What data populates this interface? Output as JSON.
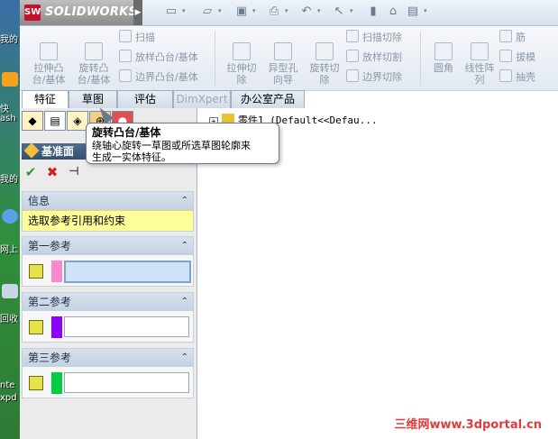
{
  "app": {
    "brand": "SOLIDWORKS",
    "logo_mark": "SW"
  },
  "desktop": {
    "labels": [
      "我的",
      "快",
      "ash",
      "我的",
      "网上",
      "回收",
      "nte",
      "xpd"
    ]
  },
  "toolbar": {
    "icons": [
      "new-file-icon",
      "open-icon",
      "save-icon",
      "print-icon",
      "undo-icon",
      "select-icon",
      "rebuild-icon",
      "file-props-icon",
      "options-icon"
    ]
  },
  "ribbon": {
    "extrude_boss": "拉伸凸\n台/基体",
    "revolve_boss": "旋转凸\n台/基体",
    "sweep": "扫描",
    "loft_boss": "放样凸台/基体",
    "boundary_boss": "边界凸台/基体",
    "extrude_cut": "拉伸切\n除",
    "hole_wizard": "异型孔\n向导",
    "revolve_cut": "旋转切\n除",
    "sweep_cut": "扫描切除",
    "loft_cut": "放样切割",
    "boundary_cut": "边界切除",
    "fillet": "圆角",
    "linear_pattern": "线性阵\n列",
    "rib": "筋",
    "draft": "拔模",
    "shell": "抽壳"
  },
  "tabs": [
    {
      "label": "特征",
      "state": "active"
    },
    {
      "label": "草图",
      "state": "normal"
    },
    {
      "label": "评估",
      "state": "normal"
    },
    {
      "label": "DimXpert",
      "state": "disabled"
    },
    {
      "label": "办公室产品",
      "state": "normal"
    }
  ],
  "property_manager": {
    "title": "基准面",
    "ok_symbol": "✔",
    "cancel_symbol": "✖",
    "pin_symbol": "⊣",
    "info": {
      "header": "信息",
      "message": "选取参考引用和约束"
    },
    "first_ref": {
      "header": "第一参考",
      "color": "#ff88cc"
    },
    "second_ref": {
      "header": "第二参考",
      "color": "#8b00ff"
    },
    "third_ref": {
      "header": "第三参考",
      "color": "#00cc44"
    },
    "collapse_symbol": "⌃"
  },
  "tree": {
    "expand_symbol": "+",
    "item": "零件1  (Default<<Defau..."
  },
  "tooltip": {
    "title": "旋转凸台/基体",
    "body": "绕轴心旋转一草图或所选草图轮廓来\n生成一实体特征。"
  },
  "watermark": "三维网www.3dportal.cn"
}
